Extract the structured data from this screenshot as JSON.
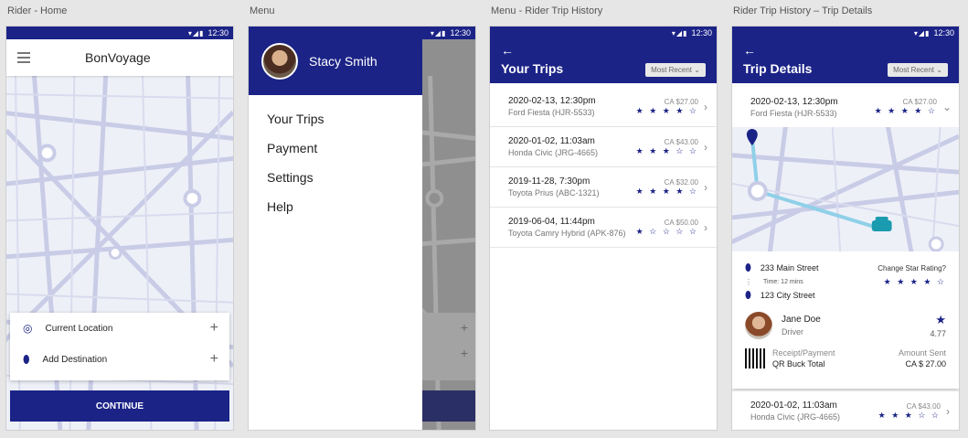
{
  "labels": {
    "home": "Rider - Home",
    "menu": "Menu",
    "history": "Menu - Rider Trip History",
    "details": "Rider Trip History – Trip Details"
  },
  "status": {
    "time": "12:30"
  },
  "home": {
    "title": "BonVoyage",
    "current_location": "Current Location",
    "add_destination": "Add Destination",
    "continue": "CONTINUE",
    "plus": "+"
  },
  "menu": {
    "user": "Stacy Smith",
    "items": [
      "Your Trips",
      "Payment",
      "Settings",
      "Help"
    ]
  },
  "history": {
    "back": "←",
    "title": "Your Trips",
    "sort": "Most Recent ⌄",
    "trips": [
      {
        "date": "2020-02-13, 12:30pm",
        "car": "Ford Fiesta (HJR-5533)",
        "price": "CA $27.00",
        "stars": "★ ★ ★ ★ ☆",
        "rating": 4
      },
      {
        "date": "2020-01-02, 11:03am",
        "car": "Honda Civic (JRG-4665)",
        "price": "CA $43.00",
        "stars": "★ ★ ★ ☆ ☆",
        "rating": 3
      },
      {
        "date": "2019-11-28, 7:30pm",
        "car": "Toyota Prius (ABC-1321)",
        "price": "CA $32.00",
        "stars": "★ ★ ★ ★ ☆",
        "rating": 4
      },
      {
        "date": "2019-06-04, 11:44pm",
        "car": "Toyota Camry Hybrid (APK-876)",
        "price": "CA $50.00",
        "stars": "★ ☆ ☆ ☆ ☆",
        "rating": 1
      }
    ]
  },
  "details": {
    "back": "←",
    "title": "Trip Details",
    "sort": "Most Recent ⌄",
    "trip": {
      "date": "2020-02-13, 12:30pm",
      "car": "Ford Fiesta (HJR-5533)",
      "price": "CA $27.00",
      "stars": "★ ★ ★ ★ ☆",
      "rating": 4
    },
    "from": "233 Main Street",
    "time": "Time: 12 mins",
    "to": "123 City Street",
    "change_rating": "Change Star Rating?",
    "change_stars": "★ ★ ★ ★ ☆",
    "driver_name": "Jane Doe",
    "driver_role": "Driver",
    "driver_rating": "4.77",
    "receipt_label": "Receipt/Payment",
    "receipt_value": "QR Buck Total",
    "amount_label": "Amount Sent",
    "amount_value": "CA $ 27.00",
    "next_trip": {
      "date": "2020-01-02, 11:03am",
      "car": "Honda Civic (JRG-4665)",
      "price": "CA $43.00",
      "stars": "★ ★ ★ ☆ ☆",
      "rating": 3
    }
  },
  "colors": {
    "primary": "#1b2387",
    "route": "#7fc4e0",
    "car": "#1a9bb0"
  }
}
